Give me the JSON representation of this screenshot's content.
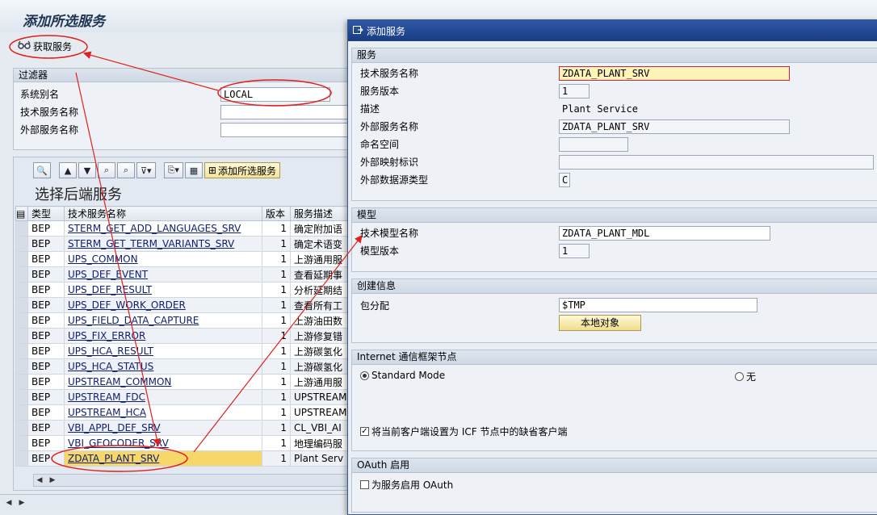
{
  "main": {
    "title": "添加所选服务",
    "get_services_label": "获取服务",
    "filter": {
      "header": "过滤器",
      "system_alias_label": "系统别名",
      "system_alias_value": "LOCAL",
      "tech_name_label": "技术服务名称",
      "ext_name_label": "外部服务名称"
    },
    "table_title": "选择后端服务",
    "add_selected_label": "添加所选服务",
    "columns": [
      "类型",
      "技术服务名称",
      "版本",
      "服务描述"
    ],
    "rows": [
      {
        "type": "BEP",
        "name": "STERM_GET_ADD_LANGUAGES_SRV",
        "ver": "1",
        "desc": "确定附加语"
      },
      {
        "type": "BEP",
        "name": "STERM_GET_TERM_VARIANTS_SRV",
        "ver": "1",
        "desc": "确定术语变"
      },
      {
        "type": "BEP",
        "name": "UPS_COMMON",
        "ver": "1",
        "desc": "上游通用服"
      },
      {
        "type": "BEP",
        "name": "UPS_DEF_EVENT",
        "ver": "1",
        "desc": "查看延期事"
      },
      {
        "type": "BEP",
        "name": "UPS_DEF_RESULT",
        "ver": "1",
        "desc": "分析延期结"
      },
      {
        "type": "BEP",
        "name": "UPS_DEF_WORK_ORDER",
        "ver": "1",
        "desc": "查看所有工"
      },
      {
        "type": "BEP",
        "name": "UPS_FIELD_DATA_CAPTURE",
        "ver": "1",
        "desc": "上游油田数"
      },
      {
        "type": "BEP",
        "name": "UPS_FIX_ERROR",
        "ver": "1",
        "desc": "上游修复错"
      },
      {
        "type": "BEP",
        "name": "UPS_HCA_RESULT",
        "ver": "1",
        "desc": "上游碳氢化"
      },
      {
        "type": "BEP",
        "name": "UPS_HCA_STATUS",
        "ver": "1",
        "desc": "上游碳氢化"
      },
      {
        "type": "BEP",
        "name": "UPSTREAM_COMMON",
        "ver": "1",
        "desc": "上游通用服"
      },
      {
        "type": "BEP",
        "name": "UPSTREAM_FDC",
        "ver": "1",
        "desc": "UPSTREAM"
      },
      {
        "type": "BEP",
        "name": "UPSTREAM_HCA",
        "ver": "1",
        "desc": "UPSTREAM"
      },
      {
        "type": "BEP",
        "name": "VBI_APPL_DEF_SRV",
        "ver": "1",
        "desc": "CL_VBI_AI"
      },
      {
        "type": "BEP",
        "name": "VBI_GEOCODER_SRV",
        "ver": "1",
        "desc": "地理编码服"
      },
      {
        "type": "BEP",
        "name": "ZDATA_PLANT_SRV",
        "ver": "1",
        "desc": "Plant Serv"
      }
    ]
  },
  "dialog": {
    "title": "添加服务",
    "service": {
      "header": "服务",
      "tech_name_label": "技术服务名称",
      "tech_name_value": "ZDATA_PLANT_SRV",
      "version_label": "服务版本",
      "version_value": "1",
      "desc_label": "描述",
      "desc_value": "Plant Service",
      "ext_name_label": "外部服务名称",
      "ext_name_value": "ZDATA_PLANT_SRV",
      "namespace_label": "命名空间",
      "ext_map_label": "外部映射标识",
      "ext_src_label": "外部数据源类型",
      "ext_src_value": "C"
    },
    "model": {
      "header": "模型",
      "name_label": "技术模型名称",
      "name_value": "ZDATA_PLANT_MDL",
      "version_label": "模型版本",
      "version_value": "1"
    },
    "creation": {
      "header": "创建信息",
      "package_label": "包分配",
      "package_value": "$TMP",
      "local_object_label": "本地对象"
    },
    "icf": {
      "header": "Internet 通信框架节点",
      "standard_mode_label": "Standard Mode",
      "none_label": "无",
      "default_client_label": "将当前客户端设置为 ICF 节点中的缺省客户端"
    },
    "oauth": {
      "header": "OAuth 启用",
      "enable_label": "为服务启用 OAuth"
    }
  },
  "colors": {
    "accent": "#193c82",
    "highlight": "#f7d66a",
    "annotation": "#e0201c"
  }
}
